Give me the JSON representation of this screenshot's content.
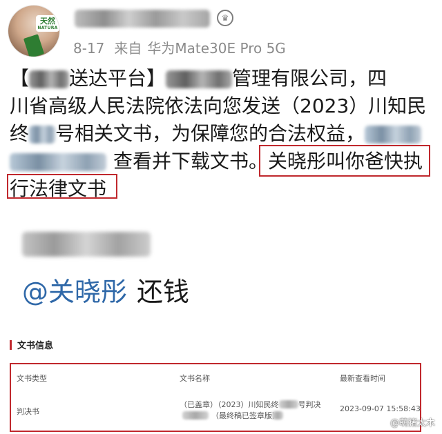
{
  "header": {
    "avatar_badge_cn": "天然",
    "avatar_badge_en": "NATURA",
    "verified_icon": "crown-icon",
    "date": "8-17",
    "source_prefix": "来自",
    "device": "华为Mate30E Pro 5G"
  },
  "post": {
    "bracket_open": "【",
    "line1_mid": "送达平台】",
    "line1_end": "管理有限公司，四",
    "line2": "川省高级人民法院依法向您发送（2023）川知民",
    "line3_start": "终",
    "line3_mid": "号相关文书，为保障您的合法权益，",
    "line4_mid": "查看并下载文书。",
    "highlight_1": "关晓彤叫你爸快执",
    "highlight_2": "行法律文书"
  },
  "mention": {
    "handle": "@关晓彤",
    "text": "还钱"
  },
  "document": {
    "section_title": "文书信息",
    "columns": [
      "文书类型",
      "文书名称",
      "最新查看时间"
    ],
    "row": {
      "type": "判决书",
      "name_part1": "（已盖章）（2023）川知民终",
      "name_part1_end": "号判决",
      "name_part2": "（最终稿已签章版）",
      "time": "2023-09-07 15:58:43"
    }
  },
  "watermark": "@萌猪太木",
  "colors": {
    "highlight_border": "#c0282d",
    "mention_blue": "#2f68a8",
    "meta_gray": "#8a8a8a"
  }
}
